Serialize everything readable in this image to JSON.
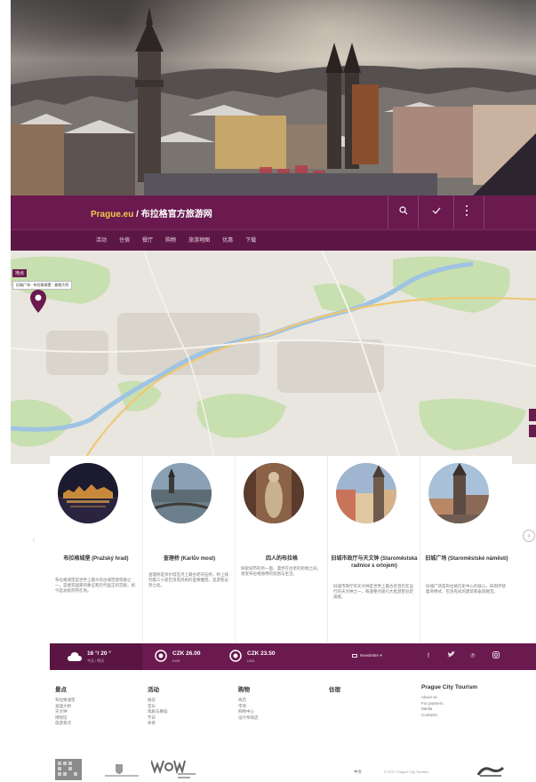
{
  "header": {
    "brand": "Prague.eu",
    "subtitle": "/ 布拉格官方旅游网",
    "icons": [
      "search-icon",
      "check-icon",
      "more-icon"
    ]
  },
  "nav": {
    "items": [
      "活动",
      "住宿",
      "餐厅",
      "购物",
      "旅游地图",
      "优惠",
      "下载"
    ]
  },
  "map": {
    "tag": "地点",
    "label": "旧城广场 · 布拉格城堡 · 查理大桥"
  },
  "cards": [
    {
      "title": "布拉格城堡 (Pražský hrad)",
      "text": "布拉格城堡是世界上最大的古城堡建筑群之一，是捷克国家的象征和历代国王的宫殿，如今是总统府所在地。"
    },
    {
      "title": "查理桥 (Karlův most)",
      "text": "查理桥是伏尔塔瓦河上最古老的石桥，桥上排列着三十座巴洛克风格的圣像雕塑，是游客必到之处。"
    },
    {
      "title": "四人的布拉格",
      "text": "探索城市的另一面，漫步在古老的街巷之间，感受布拉格独特的氛围与生活。"
    },
    {
      "title": "旧城市政厅与天文钟 (Staroměstská radnice s orlojem)",
      "text": "旧城市政厅的天文钟是世界上最古老且仍在运行的天文钟之一，每逢整点吸引大批游客驻足观看。"
    },
    {
      "title": "旧城广场 (Staroměstské náměstí)",
      "text": "旧城广场是布拉格历史中心的核心，四周环绕着哥特式、巴洛克式的建筑和泰恩教堂。"
    }
  ],
  "infobar": {
    "weather_main": "16 °/ 20 °",
    "weather_sub": "今天 / 明天",
    "rate1_main": "CZK 26.00",
    "rate1_sub": "EUR",
    "rate2_main": "CZK 23.50",
    "rate2_sub": "USD",
    "newsletter": "Newsletter  ▾",
    "social": [
      "facebook-icon",
      "twitter-icon",
      "pinterest-icon",
      "instagram-icon"
    ]
  },
  "footer": {
    "cols": [
      {
        "head": "景点",
        "links": [
          "布拉格城堡",
          "查理大桥",
          "天文钟",
          "博物馆",
          "旅游景点"
        ]
      },
      {
        "head": "活动",
        "links": [
          "展览",
          "音乐",
          "戏剧与舞蹈",
          "节日",
          "体育"
        ]
      },
      {
        "head": "购物",
        "links": [
          "商店",
          "市场",
          "购物中心",
          "设计师商店"
        ]
      },
      {
        "head": "住宿",
        "links": []
      },
      {
        "head": "Prague City Tourism",
        "links": [
          "About us",
          "For partners",
          "Media",
          "Contacts"
        ]
      }
    ],
    "lang": "中文",
    "copyright": "© 2017 Prague City Tourism"
  },
  "colors": {
    "primary": "#6a1a4f",
    "nav": "#5d1746",
    "accent": "#f2c94c"
  }
}
